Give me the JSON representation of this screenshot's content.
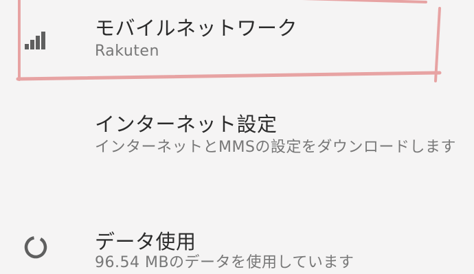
{
  "settings": {
    "items": [
      {
        "title": "モバイルネットワーク",
        "subtitle": "Rakuten",
        "icon": "signal-icon"
      },
      {
        "title": "インターネット設定",
        "subtitle": "インターネットとMMSの設定をダウンロードします"
      },
      {
        "title": "データ使用",
        "subtitle": "96.54 MBのデータを使用しています",
        "icon": "data-usage-icon"
      }
    ]
  },
  "colors": {
    "background": "#f5f4f4",
    "title": "#2b2b2b",
    "subtitle": "#777777",
    "icon": "#5f5f5f",
    "highlight_marker": "#e7a3a3"
  }
}
